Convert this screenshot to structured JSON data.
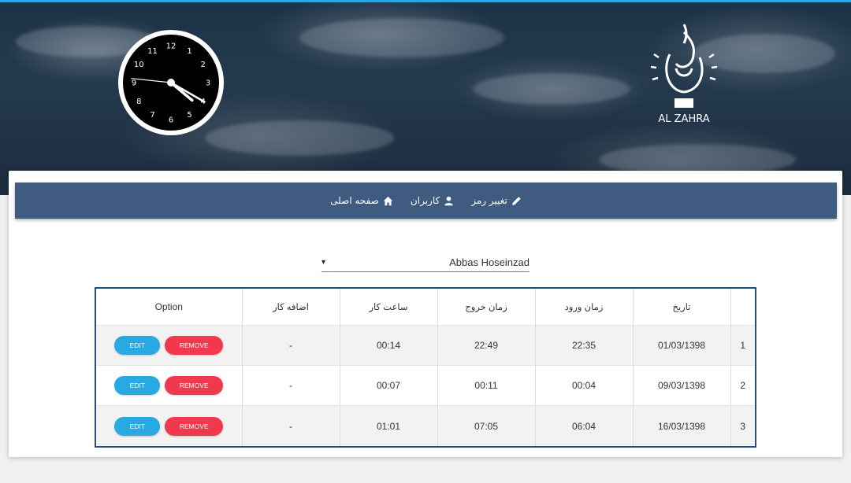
{
  "colors": {
    "accent": "#29a8e0",
    "navbar": "#3f5b7f",
    "table_border": "#1f4f7a",
    "edit": "#29a9e2",
    "remove": "#f0394c"
  },
  "clock": {
    "numbers": [
      "12",
      "1",
      "2",
      "3",
      "4",
      "5",
      "6",
      "7",
      "8",
      "9",
      "10",
      "11"
    ],
    "hour": 4,
    "minute": 20,
    "second": 46
  },
  "logo": {
    "name": "AL ZAHRA"
  },
  "nav": {
    "home": {
      "label": "صفحه اصلی",
      "icon": "home-icon"
    },
    "users": {
      "label": "کاربران",
      "icon": "user-icon"
    },
    "password": {
      "label": "تغییر رمز",
      "icon": "pencil-icon"
    }
  },
  "user_select": {
    "value": "Abbas Hoseinzad",
    "arrow": "▾"
  },
  "table": {
    "headers": {
      "date": "تاریخ",
      "entry": "زمان ورود",
      "exit": "زمان خروج",
      "work": "ساعت کار",
      "overtime": "اضافه کار",
      "option": "Option"
    },
    "edit_label": "EDIT",
    "remove_label": "REMOVE",
    "rows": [
      {
        "num": "1",
        "date": "01/03/1398",
        "entry": "22:35",
        "exit": "22:49",
        "work": "00:14",
        "overtime": "-"
      },
      {
        "num": "2",
        "date": "09/03/1398",
        "entry": "00:04",
        "exit": "00:11",
        "work": "00:07",
        "overtime": "-"
      },
      {
        "num": "3",
        "date": "16/03/1398",
        "entry": "06:04",
        "exit": "07:05",
        "work": "01:01",
        "overtime": "-"
      }
    ]
  }
}
